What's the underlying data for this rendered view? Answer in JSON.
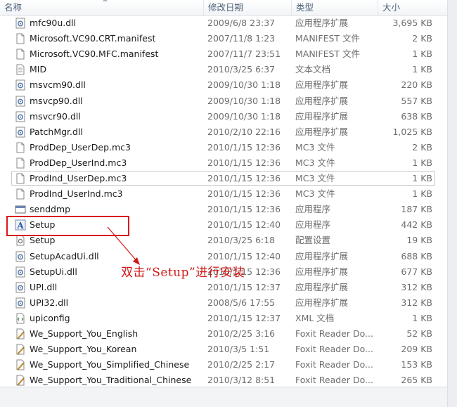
{
  "columns": {
    "name": "名称",
    "date": "修改日期",
    "type": "类型",
    "size": "大小"
  },
  "files": [
    {
      "name": "mfc90u.dll",
      "date": "2009/6/8 23:37",
      "type": "应用程序扩展",
      "size": "3,695 KB",
      "icon": "dll-gear-icon"
    },
    {
      "name": "Microsoft.VC90.CRT.manifest",
      "date": "2007/11/8 1:23",
      "type": "MANIFEST 文件",
      "size": "2 KB",
      "icon": "blank-file-icon"
    },
    {
      "name": "Microsoft.VC90.MFC.manifest",
      "date": "2007/11/7 23:51",
      "type": "MANIFEST 文件",
      "size": "1 KB",
      "icon": "blank-file-icon"
    },
    {
      "name": "MID",
      "date": "2010/3/25 6:37",
      "type": "文本文档",
      "size": "1 KB",
      "icon": "text-file-icon"
    },
    {
      "name": "msvcm90.dll",
      "date": "2009/10/30 1:18",
      "type": "应用程序扩展",
      "size": "220 KB",
      "icon": "dll-gear-icon"
    },
    {
      "name": "msvcp90.dll",
      "date": "2009/10/30 1:18",
      "type": "应用程序扩展",
      "size": "557 KB",
      "icon": "dll-gear-icon"
    },
    {
      "name": "msvcr90.dll",
      "date": "2009/10/30 1:18",
      "type": "应用程序扩展",
      "size": "638 KB",
      "icon": "dll-gear-icon"
    },
    {
      "name": "PatchMgr.dll",
      "date": "2010/2/10 22:16",
      "type": "应用程序扩展",
      "size": "1,025 KB",
      "icon": "dll-gear-icon"
    },
    {
      "name": "ProdDep_UserDep.mc3",
      "date": "2010/1/15 12:36",
      "type": "MC3 文件",
      "size": "2 KB",
      "icon": "blank-file-icon"
    },
    {
      "name": "ProdDep_UserInd.mc3",
      "date": "2010/1/15 12:36",
      "type": "MC3 文件",
      "size": "1 KB",
      "icon": "blank-file-icon"
    },
    {
      "name": "ProdInd_UserDep.mc3",
      "date": "2010/1/15 12:36",
      "type": "MC3 文件",
      "size": "1 KB",
      "icon": "blank-file-icon",
      "outlined": true
    },
    {
      "name": "ProdInd_UserInd.mc3",
      "date": "2010/1/15 12:36",
      "type": "MC3 文件",
      "size": "1 KB",
      "icon": "blank-file-icon"
    },
    {
      "name": "senddmp",
      "date": "2010/1/15 12:36",
      "type": "应用程序",
      "size": "187 KB",
      "icon": "exe-window-icon"
    },
    {
      "name": "Setup",
      "date": "2010/1/15 12:40",
      "type": "应用程序",
      "size": "442 KB",
      "icon": "setup-app-icon"
    },
    {
      "name": "Setup",
      "date": "2010/3/25 6:18",
      "type": "配置设置",
      "size": "19 KB",
      "icon": "config-file-icon"
    },
    {
      "name": "SetupAcadUi.dll",
      "date": "2010/1/15 12:40",
      "type": "应用程序扩展",
      "size": "688 KB",
      "icon": "dll-gear-icon"
    },
    {
      "name": "SetupUi.dll",
      "date": "2010/1/15 12:36",
      "type": "应用程序扩展",
      "size": "677 KB",
      "icon": "dll-gear-icon"
    },
    {
      "name": "UPI.dll",
      "date": "2010/1/15 12:37",
      "type": "应用程序扩展",
      "size": "312 KB",
      "icon": "dll-gear-icon"
    },
    {
      "name": "UPI32.dll",
      "date": "2008/5/6 17:55",
      "type": "应用程序扩展",
      "size": "312 KB",
      "icon": "dll-gear-icon"
    },
    {
      "name": "upiconfig",
      "date": "2010/1/15 12:37",
      "type": "XML 文档",
      "size": "1 KB",
      "icon": "xml-file-icon"
    },
    {
      "name": "We_Support_You_English",
      "date": "2010/2/25 3:16",
      "type": "Foxit Reader Do...",
      "size": "52 KB",
      "icon": "foxit-doc-icon"
    },
    {
      "name": "We_Support_You_Korean",
      "date": "2010/3/5 1:51",
      "type": "Foxit Reader Do...",
      "size": "209 KB",
      "icon": "foxit-doc-icon"
    },
    {
      "name": "We_Support_You_Simplified_Chinese",
      "date": "2010/2/25 2:17",
      "type": "Foxit Reader Do...",
      "size": "153 KB",
      "icon": "foxit-doc-icon"
    },
    {
      "name": "We_Support_You_Traditional_Chinese",
      "date": "2010/3/12 8:51",
      "type": "Foxit Reader Do...",
      "size": "265 KB",
      "icon": "foxit-doc-icon"
    }
  ],
  "annotation": {
    "text": "双击“Setup”进行安装",
    "color": "#d01818"
  },
  "colors": {
    "header_text": "#4c607a",
    "detail_text": "#6d6d6d",
    "highlight_border": "#d91a1a"
  }
}
